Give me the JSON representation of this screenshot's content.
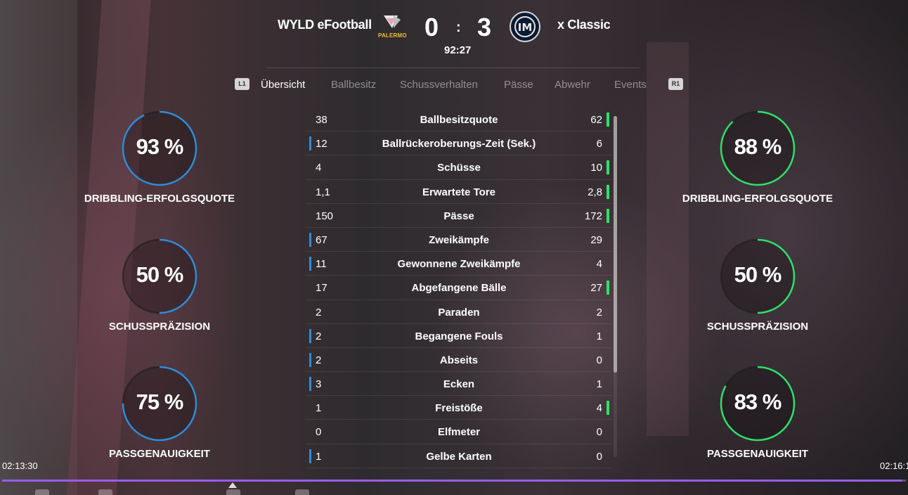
{
  "header": {
    "home_team": "WYLD eFootball",
    "away_team": "x Classic",
    "home_logo_text": "PALERMO",
    "home_score": "0",
    "separator": ":",
    "away_score": "3",
    "match_clock": "92:27"
  },
  "tabs": {
    "left_button": "L1",
    "right_button": "R1",
    "items": [
      "Übersicht",
      "Ballbesitz",
      "Schussverhalten",
      "Pässe",
      "Abwehr",
      "Events"
    ],
    "active": "Übersicht"
  },
  "stats": [
    {
      "home": "38",
      "label": "Ballbesitzquote",
      "away": "62",
      "leader": "away"
    },
    {
      "home": "12",
      "label": "Ballrückeroberungs-Zeit (Sek.)",
      "away": "6",
      "leader": "home"
    },
    {
      "home": "4",
      "label": "Schüsse",
      "away": "10",
      "leader": "away"
    },
    {
      "home": "1,1",
      "label": "Erwartete Tore",
      "away": "2,8",
      "leader": "away"
    },
    {
      "home": "150",
      "label": "Pässe",
      "away": "172",
      "leader": "away"
    },
    {
      "home": "67",
      "label": "Zweikämpfe",
      "away": "29",
      "leader": "home"
    },
    {
      "home": "11",
      "label": "Gewonnene Zweikämpfe",
      "away": "4",
      "leader": "home"
    },
    {
      "home": "17",
      "label": "Abgefangene Bälle",
      "away": "27",
      "leader": "away"
    },
    {
      "home": "2",
      "label": "Paraden",
      "away": "2",
      "leader": "none"
    },
    {
      "home": "2",
      "label": "Begangene Fouls",
      "away": "1",
      "leader": "home"
    },
    {
      "home": "2",
      "label": "Abseits",
      "away": "0",
      "leader": "home"
    },
    {
      "home": "3",
      "label": "Ecken",
      "away": "1",
      "leader": "home"
    },
    {
      "home": "1",
      "label": "Freistöße",
      "away": "4",
      "leader": "away"
    },
    {
      "home": "0",
      "label": "Elfmeter",
      "away": "0",
      "leader": "none"
    },
    {
      "home": "1",
      "label": "Gelbe Karten",
      "away": "0",
      "leader": "home"
    }
  ],
  "rings_home": [
    {
      "value": "93 %",
      "percent": 93,
      "label": "DRIBBLING-ERFOLGSQUOTE"
    },
    {
      "value": "50 %",
      "percent": 50,
      "label": "SCHUSSPRÄZISION"
    },
    {
      "value": "75 %",
      "percent": 75,
      "label": "PASSGENAUIGKEIT"
    }
  ],
  "rings_away": [
    {
      "value": "88 %",
      "percent": 88,
      "label": "DRIBBLING-ERFOLGSQUOTE"
    },
    {
      "value": "50 %",
      "percent": 50,
      "label": "SCHUSSPRÄZISION"
    },
    {
      "value": "83 %",
      "percent": 83,
      "label": "PASSGENAUIGKEIT"
    }
  ],
  "colors": {
    "home_accent": "#2f8cd8",
    "away_accent": "#2ee06a",
    "progress": "#9a5cf0"
  },
  "video": {
    "current_time": "02:13:30",
    "end_time": "02:16:1",
    "progress_percent": 99.6
  }
}
